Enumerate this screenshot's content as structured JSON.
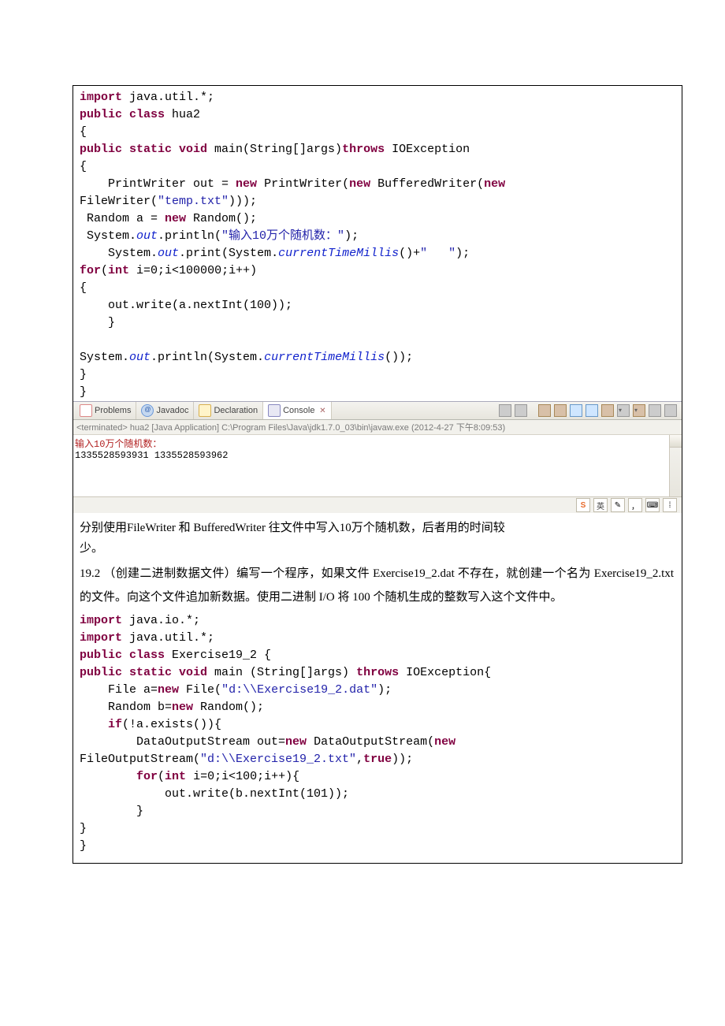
{
  "code1": {
    "l1a": "import",
    "l1b": " java.util.*;",
    "l2a": "public class",
    "l2b": " hua2",
    "l3": "{",
    "l4a": "public static void",
    "l4b": " main(String[]args)",
    "l4c": "throws",
    "l4d": " IOException",
    "l5": "{",
    "l6a": "    PrintWriter out = ",
    "l6b": "new",
    "l6c": " PrintWriter(",
    "l6d": "new",
    "l6e": " BufferedWriter(",
    "l6f": "new",
    "l7a": "FileWriter(",
    "l7b": "\"temp.txt\"",
    "l7c": ")));",
    "l8a": " Random a = ",
    "l8b": "new",
    "l8c": " Random();",
    "l9a": " System.",
    "l9b": "out",
    "l9c": ".println(",
    "l9d": "\"输入10万个随机数：\"",
    "l9e": ");",
    "l10a": "    System.",
    "l10b": "out",
    "l10c": ".print(System.",
    "l10d": "currentTimeMillis",
    "l10e": "()+",
    "l10f": "\"   \"",
    "l10g": ");",
    "l11a": "for",
    "l11b": "(",
    "l11c": "int",
    "l11d": " i=0;i<100000;i++)",
    "l12": "{",
    "l13": "    out.write(a.nextInt(100));",
    "l14": "    }",
    "l15": "",
    "l16a": "System.",
    "l16b": "out",
    "l16c": ".println(System.",
    "l16d": "currentTimeMillis",
    "l16e": "());",
    "l17": "}",
    "l18": "}"
  },
  "tabs": {
    "problems": "Problems",
    "javadoc": "Javadoc",
    "declaration": "Declaration",
    "console": "Console"
  },
  "console": {
    "terminated": "<terminated> hua2 [Java Application] C:\\Program Files\\Java\\jdk1.7.0_03\\bin\\javaw.exe (2012-4-27 下午8:09:53)",
    "line1": "输入10万个随机数：",
    "line2": "1335528593931     1335528593962"
  },
  "ime": {
    "s": "S",
    "lang": "英",
    "kb": "⌨"
  },
  "para1a": "分别使用FileWriter 和 BufferedWriter 往文件中写入10万个随机数，后者用的时间较",
  "para1b": "少。",
  "sec19_2": "19.2 （创建二进制数据文件）编写一个程序，如果文件 Exercise19_2.dat 不存在，就创建一个名为 Exercise19_2.txt 的文件。向这个文件追加新数据。使用二进制 I/O 将 100 个随机生成的整数写入这个文件中。",
  "code2": {
    "l1a": "import",
    "l1b": " java.io.*;",
    "l2a": "import",
    "l2b": " java.util.*;",
    "l3a": "public class",
    "l3b": " Exercise19_2 {",
    "l4a": "public static void",
    "l4b": " main (String[]args) ",
    "l4c": "throws",
    "l4d": " IOException{",
    "l5a": "    File a=",
    "l5b": "new",
    "l5c": " File(",
    "l5d": "\"d:\\\\Exercise19_2.dat\"",
    "l5e": ");",
    "l6a": "    Random b=",
    "l6b": "new",
    "l6c": " Random();",
    "l7a": "    ",
    "l7b": "if",
    "l7c": "(!a.exists()){",
    "l8a": "        DataOutputStream out=",
    "l8b": "new",
    "l8c": " DataOutputStream(",
    "l8d": "new",
    "l9a": "FileOutputStream(",
    "l9b": "\"d:\\\\Exercise19_2.txt\"",
    "l9c": ",",
    "l9d": "true",
    "l9e": "));",
    "l10a": "        ",
    "l10b": "for",
    "l10c": "(",
    "l10d": "int",
    "l10e": " i=0;i<100;i++){",
    "l11": "            out.write(b.nextInt(101));",
    "l12": "        }",
    "l13": "}",
    "l14": "}"
  }
}
